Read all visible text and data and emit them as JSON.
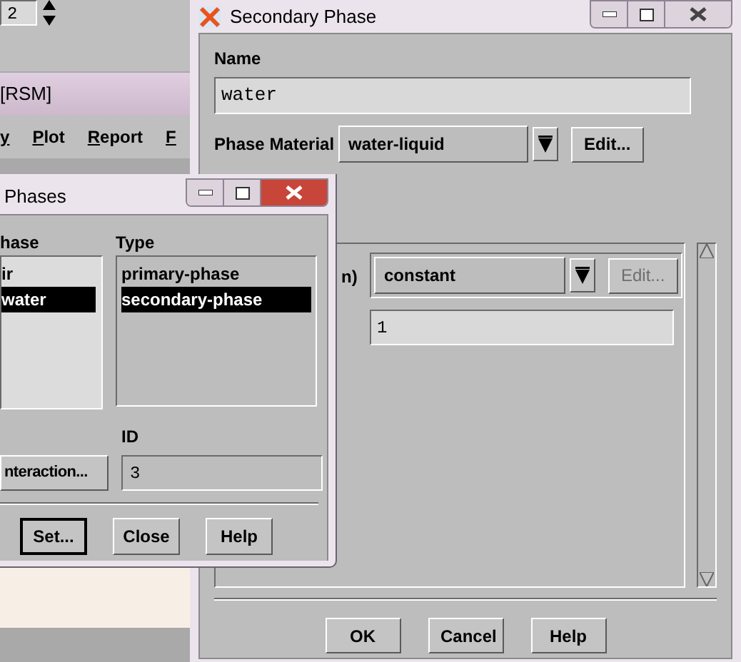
{
  "background_window": {
    "spinner_value": "2",
    "title": "[RSM]",
    "menu": [
      "y",
      "Plot",
      "Report",
      "F"
    ]
  },
  "secondary_phase": {
    "title": "Secondary Phase",
    "name_label": "Name",
    "name_value": "water",
    "material_label": "Phase Material",
    "material_value": "water-liquid",
    "material_edit": "Edit...",
    "property_label": "n)",
    "property_value": "constant",
    "property_edit": {
      "label": "Edit...",
      "disabled": true
    },
    "property_field": "1",
    "buttons": [
      "OK",
      "Cancel",
      "Help"
    ]
  },
  "phases": {
    "title": "Phases",
    "phase_label": "hase",
    "phase_items": [
      {
        "label": "ir",
        "selected": false
      },
      {
        "label": "water",
        "selected": true
      }
    ],
    "type_label": "Type",
    "type_items": [
      {
        "label": "primary-phase",
        "selected": false
      },
      {
        "label": "secondary-phase",
        "selected": true
      }
    ],
    "interaction_button": "nteraction...",
    "id_label": "ID",
    "id_value": "3",
    "buttons": [
      {
        "label": "Set...",
        "default": true
      },
      {
        "label": "Close",
        "default": false
      },
      {
        "label": "Help",
        "default": false
      }
    ]
  }
}
